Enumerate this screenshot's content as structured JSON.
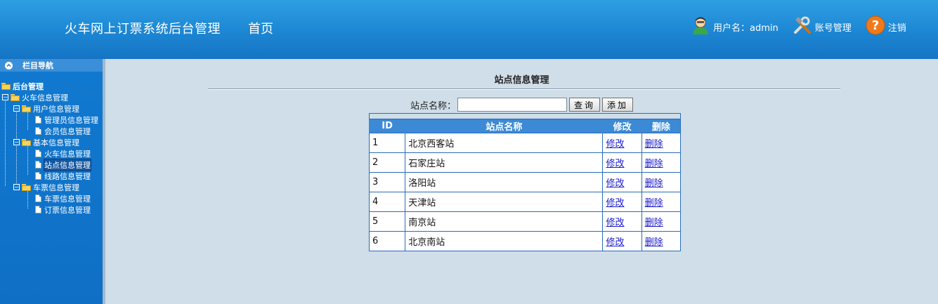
{
  "header": {
    "app_title": "火车网上订票系统后台管理",
    "home": "首页",
    "username_label": "用户名：admin",
    "account_manage": "账号管理",
    "logout": "注销"
  },
  "sidebar": {
    "nav_title": "栏目导航",
    "tree": [
      {
        "label": "后台管理",
        "level": 0
      },
      {
        "label": "火车信息管理",
        "level": 0
      },
      {
        "label": "用户信息管理",
        "level": 1
      },
      {
        "label": "管理员信息管理",
        "level": 2
      },
      {
        "label": "会员信息管理",
        "level": 2
      },
      {
        "label": "基本信息管理",
        "level": 1
      },
      {
        "label": "火车信息管理",
        "level": 2
      },
      {
        "label": "站点信息管理",
        "level": 2,
        "selected": true
      },
      {
        "label": "线路信息管理",
        "level": 2
      },
      {
        "label": "车票信息管理",
        "level": 1
      },
      {
        "label": "车票信息管理",
        "level": 2
      },
      {
        "label": "订票信息管理",
        "level": 2
      }
    ]
  },
  "main": {
    "page_title": "站点信息管理",
    "search_label": "站点名称：",
    "search_value": "",
    "query_button": "查询",
    "add_button": "添加",
    "table": {
      "columns": [
        "ID",
        "站点名称",
        "修改",
        "删除"
      ],
      "rows": [
        {
          "id": "1",
          "name": "北京西客站",
          "edit": "修改",
          "delete": "删除"
        },
        {
          "id": "2",
          "name": "石家庄站",
          "edit": "修改",
          "delete": "删除"
        },
        {
          "id": "3",
          "name": "洛阳站",
          "edit": "修改",
          "delete": "删除"
        },
        {
          "id": "4",
          "name": "天津站",
          "edit": "修改",
          "delete": "删除"
        },
        {
          "id": "5",
          "name": "南京站",
          "edit": "修改",
          "delete": "删除"
        },
        {
          "id": "6",
          "name": "北京南站",
          "edit": "修改",
          "delete": "删除"
        }
      ]
    }
  },
  "colors": {
    "header_blue": "#1c86d3",
    "sidebar_blue": "#1179d0",
    "content_bg": "#cfdee8",
    "table_header": "#3c8ad6",
    "link": "#1a1acc"
  }
}
